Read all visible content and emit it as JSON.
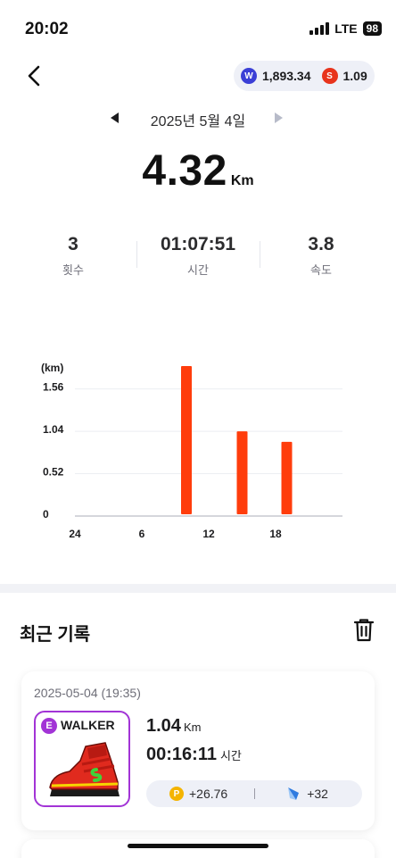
{
  "status_bar": {
    "time": "20:02",
    "network": "LTE",
    "battery": "98"
  },
  "header": {
    "back_icon": "chevron-left-icon",
    "balance_w": "1,893.34",
    "balance_s": "1.09",
    "coin_w_letter": "W",
    "coin_s_letter": "S"
  },
  "date_nav": {
    "date": "2025년 5월 4일",
    "prev_icon": "triangle-left-icon",
    "next_icon": "triangle-right-icon"
  },
  "summary": {
    "distance": "4.32",
    "distance_unit": "Km"
  },
  "stats": [
    {
      "value": "3",
      "label": "횟수"
    },
    {
      "value": "01:07:51",
      "label": "시간"
    },
    {
      "value": "3.8",
      "label": "속도"
    }
  ],
  "chart_data": {
    "type": "bar",
    "ylabel": "(km)",
    "ylim": [
      0,
      1.95
    ],
    "y_ticks": [
      "0",
      "0.52",
      "1.04",
      "1.56"
    ],
    "x_ticks": [
      "24",
      "6",
      "12",
      "18"
    ],
    "x_range": [
      0,
      24
    ],
    "bars": [
      {
        "hour": 10,
        "value": 1.84
      },
      {
        "hour": 15,
        "value": 1.04
      },
      {
        "hour": 19,
        "value": 0.91
      }
    ],
    "bar_color": "#ff3d0c",
    "grid": true
  },
  "recent": {
    "title": "최근 기록",
    "trash_icon": "trash-icon",
    "record": {
      "datetime": "2025-05-04 (19:35)",
      "shoe_badge": "E",
      "shoe_name": "WALKER",
      "distance": "1.04",
      "distance_unit": "Km",
      "time": "00:16:11",
      "time_unit": "시간",
      "reward_p_letter": "P",
      "reward_points": "+26.76",
      "reward_gem": "+32"
    }
  },
  "colors": {
    "accent": "#ff3d0c",
    "shoe_border": "#a234d6",
    "pill_bg": "#eef0f7"
  }
}
